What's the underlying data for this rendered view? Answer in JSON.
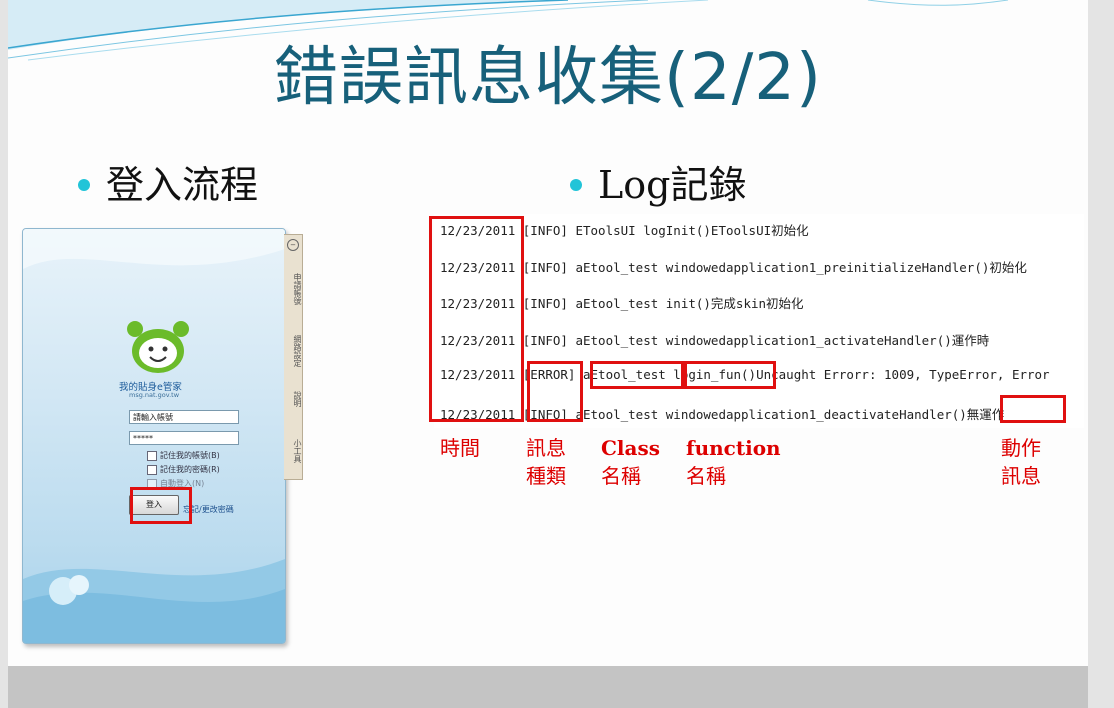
{
  "slide": {
    "title": "錯誤訊息收集(2/2)",
    "left_bullet": "登入流程",
    "right_bullet": "Log記錄"
  },
  "login_screen": {
    "brand": "我的貼身e管家",
    "brand_url": "msg.nat.gov.tw",
    "username_value": "請輸入帳號",
    "password_value": "*****",
    "remember_account": "記住我的帳號(B)",
    "remember_password": "記住我的密碼(R)",
    "auto_login": "自動登入(N)",
    "login_button": "登入",
    "forgot_link": "忘記/更改密碼",
    "side_tabs": [
      "申請帳號",
      "網路設定",
      "說明",
      "小工具"
    ]
  },
  "log": {
    "lines": [
      "12/23/2011 [INFO] EToolsUI logInit()EToolsUI初始化",
      "12/23/2011 [INFO] aEtool_test windowedapplication1_preinitializeHandler()初始化",
      "12/23/2011 [INFO] aEtool_test init()完成skin初始化",
      "12/23/2011 [INFO] aEtool_test windowedapplication1_activateHandler()運作時",
      "12/23/2011 [ERROR] aEtool_test login_fun()Uncaught Errorr: 1009, TypeError, Error",
      "12/23/2011 [INFO] aEtool_test windowedapplication1_deactivateHandler()無運作"
    ]
  },
  "labels": {
    "time": "時間",
    "msg_type_1": "訊息",
    "msg_type_2": "種類",
    "class_1": "Class",
    "class_2": "名稱",
    "function_1": "function",
    "function_2": "名稱",
    "action_1": "動作",
    "action_2": "訊息"
  },
  "colors": {
    "title": "#17607a",
    "bullet_dot": "#22c4d8",
    "highlight": "#e01010",
    "label": "#dd0000"
  }
}
